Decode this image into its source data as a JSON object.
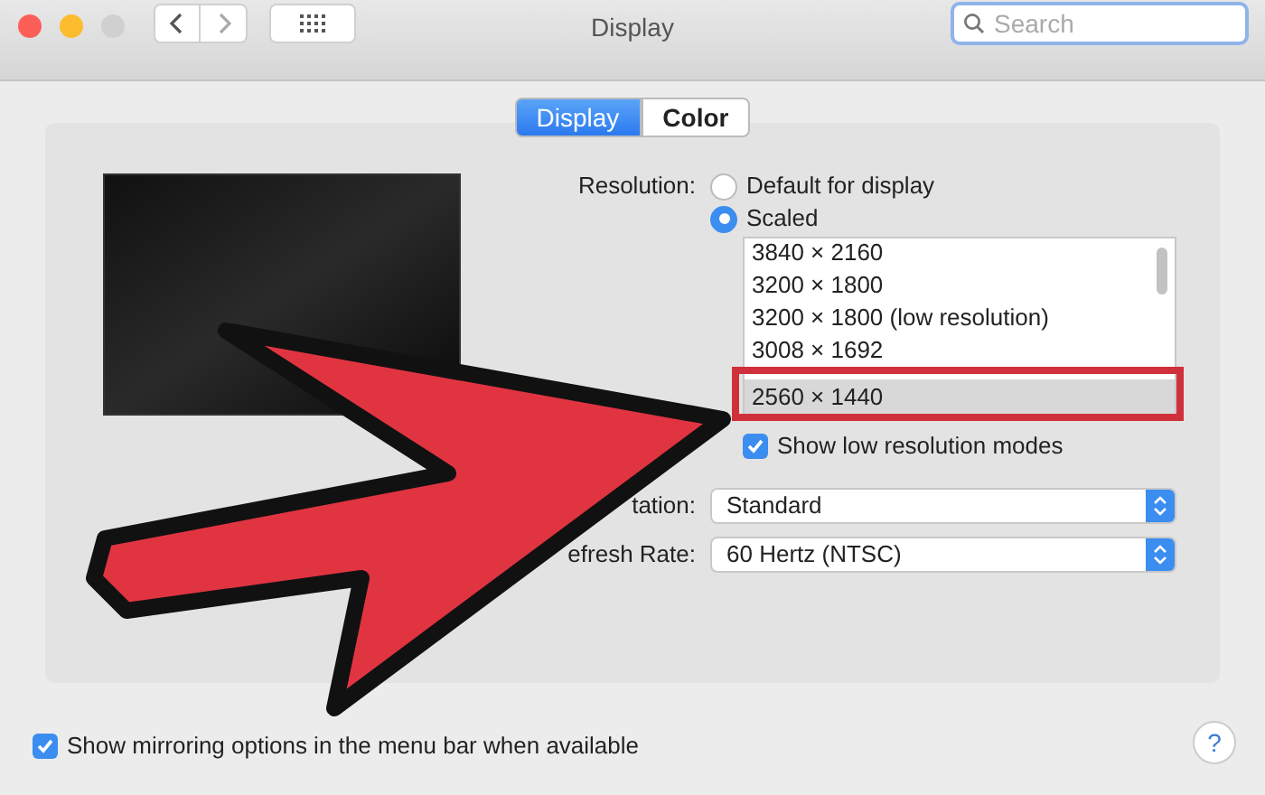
{
  "window": {
    "title": "Display",
    "search": {
      "placeholder": "Search"
    }
  },
  "tabs": [
    {
      "label": "Display",
      "selected": true
    },
    {
      "label": "Color",
      "selected": false
    }
  ],
  "resolution": {
    "label": "Resolution:",
    "options": [
      {
        "label": "Default for display",
        "selected": false
      },
      {
        "label": "Scaled",
        "selected": true
      }
    ],
    "list": [
      {
        "label": "3840 × 2160",
        "selected": false
      },
      {
        "label": "3200 × 1800",
        "selected": false
      },
      {
        "label": "3200 × 1800 (low resolution)",
        "selected": false
      },
      {
        "label": "3008 × 1692",
        "selected": false
      },
      {
        "label": "2560 × 1440",
        "selected": true
      }
    ],
    "low_res": {
      "label": "Show low resolution modes",
      "checked": true
    }
  },
  "rotation": {
    "label": "tation:",
    "value": "Standard"
  },
  "refresh_rate": {
    "label": "efresh Rate:",
    "value": "60 Hertz (NTSC)"
  },
  "mirroring": {
    "label": "Show mirroring options in the menu bar when available",
    "checked": true
  },
  "help": {
    "label": "?"
  }
}
